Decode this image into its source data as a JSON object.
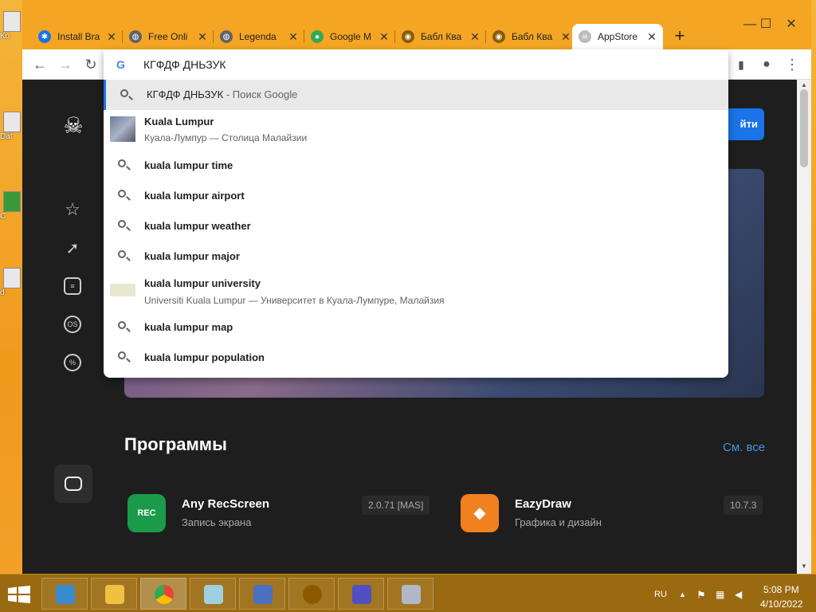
{
  "window": {
    "minimize": "—",
    "maximize": "☐",
    "close": "✕"
  },
  "tabs": [
    {
      "title": "Install Bra",
      "color": "#1a73e8"
    },
    {
      "title": "Free Onli",
      "color": "#5f6368"
    },
    {
      "title": "Legenda",
      "color": "#5f6368"
    },
    {
      "title": "Google M",
      "color": "#34a853"
    },
    {
      "title": "Бабл Ква",
      "color": "#8a5a00"
    },
    {
      "title": "Бабл Ква",
      "color": "#8a5a00"
    },
    {
      "title": "AppStore",
      "color": "#888888"
    }
  ],
  "toolbar": {
    "back": "←",
    "forward": "→",
    "reload": "↻",
    "menu": "⋮",
    "profile": "●",
    "sidebar": "▮"
  },
  "omnibox": {
    "g_label": "G",
    "input_value": "КГФДФ ДНЬЗУК",
    "suggestions": [
      {
        "type": "search",
        "text": "КГФДФ ДНЬЗУК",
        "suffix": " - Поиск Google"
      },
      {
        "type": "entity",
        "text": "Kuala Lumpur",
        "sub": "Куала-Лумпур — Столица Малайзии"
      },
      {
        "type": "search",
        "text": "kuala lumpur time"
      },
      {
        "type": "search",
        "text": "kuala lumpur airport"
      },
      {
        "type": "search",
        "text": "kuala lumpur weather"
      },
      {
        "type": "search",
        "text": "kuala lumpur major"
      },
      {
        "type": "entity",
        "text": "kuala lumpur university",
        "sub": "Universiti Kuala Lumpur — Университет в Куала-Лумпуре, Малайзия"
      },
      {
        "type": "search",
        "text": "kuala lumpur map"
      },
      {
        "type": "search",
        "text": "kuala lumpur population"
      }
    ]
  },
  "page": {
    "cta_label": "йти",
    "section_title": "Программы",
    "see_all": "См. все",
    "apps": [
      {
        "name": "Any RecScreen",
        "category": "Запись экрана",
        "version": "2.0.71 [MAS]",
        "icon_text": "REC"
      },
      {
        "name": "EazyDraw",
        "category": "Графика и дизайн",
        "version": "10.7.3",
        "icon_text": "◆"
      }
    ],
    "side_icons": [
      "star-icon",
      "rocket-icon",
      "document-icon",
      "os-icon",
      "percent-icon"
    ],
    "os_label": "OS",
    "percent_label": "%"
  },
  "desktop": {
    "icon_labels": [
      "Ko",
      "Dat",
      "C",
      "d"
    ]
  },
  "taskbar": {
    "lang": "RU",
    "time": "5:08 PM",
    "date": "4/10/2022"
  }
}
